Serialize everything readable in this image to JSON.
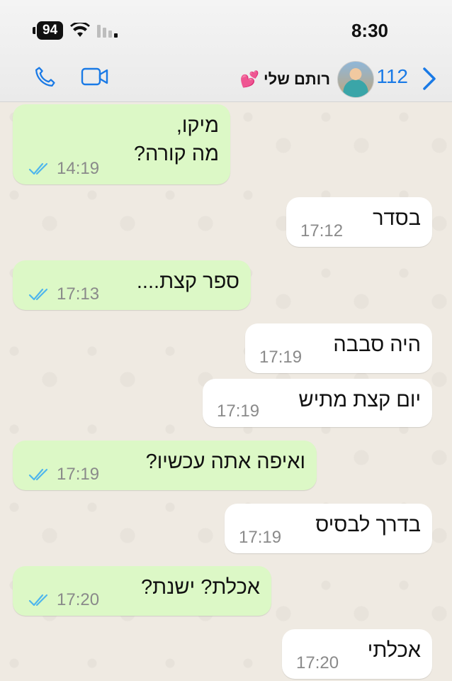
{
  "status_bar": {
    "battery": "94",
    "time": "8:30"
  },
  "header": {
    "unread_count": "112",
    "contact_name": "רותם שלי 💕"
  },
  "colors": {
    "accent": "#1a7ae6",
    "outgoing_bubble": "#dcf8c6",
    "incoming_bubble": "#ffffff",
    "read_tick": "#4fb6ec"
  },
  "messages": [
    {
      "direction": "out",
      "text": "מיקו,\nמה קורה?",
      "time": "14:19"
    },
    {
      "direction": "in",
      "text": "בסדר",
      "time": "17:12"
    },
    {
      "direction": "out",
      "text": "ספר קצת....",
      "time": "17:13"
    },
    {
      "direction": "in",
      "text": "היה סבבה",
      "time": "17:19"
    },
    {
      "direction": "in",
      "text": "יום קצת מתיש",
      "time": "17:19"
    },
    {
      "direction": "out",
      "text": "ואיפה אתה עכשיו?",
      "time": "17:19"
    },
    {
      "direction": "in",
      "text": "בדרך לבסיס",
      "time": "17:19"
    },
    {
      "direction": "out",
      "text": "אכלת? ישנת?",
      "time": "17:20"
    },
    {
      "direction": "in",
      "text": "אכלתי",
      "time": "17:20"
    }
  ]
}
